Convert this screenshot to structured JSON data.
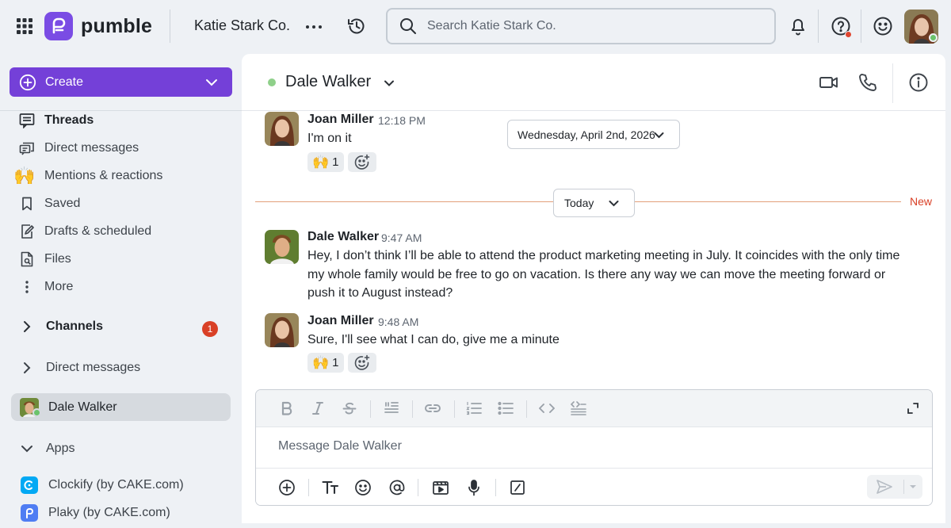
{
  "app": {
    "brand": "pumble",
    "workspace": "Katie Stark Co.",
    "search_placeholder": "Search Katie Stark Co."
  },
  "sidebar": {
    "create_label": "Create",
    "nav": [
      {
        "label": "Threads",
        "icon": "threads-icon",
        "bold": true
      },
      {
        "label": "Direct messages",
        "icon": "direct-messages-icon"
      },
      {
        "label": "Mentions & reactions",
        "icon": "raised-hands-icon"
      },
      {
        "label": "Saved",
        "icon": "bookmark-icon"
      },
      {
        "label": "Drafts & scheduled",
        "icon": "drafts-icon"
      },
      {
        "label": "Files",
        "icon": "files-icon"
      },
      {
        "label": "More",
        "icon": "more-vertical-icon"
      }
    ],
    "channels_label": "Channels",
    "channels_badge": "1",
    "direct_messages_label": "Direct messages",
    "active_dm": "Dale Walker",
    "apps_label": "Apps",
    "apps": [
      {
        "label": "Clockify (by CAKE.com)",
        "color": "#03a9f4"
      },
      {
        "label": "Plaky (by CAKE.com)",
        "color": "#4f7df3"
      }
    ]
  },
  "chat": {
    "title": "Dale Walker",
    "date_pill": "Wednesday, April 2nd, 2026",
    "today_label": "Today",
    "new_label": "New",
    "messages": [
      {
        "author": "Joan Miller",
        "time": "12:18 PM",
        "lines": [
          "I'm on it"
        ],
        "reaction": {
          "emoji": "🙌",
          "count": "1"
        }
      },
      {
        "author": "Dale Walker",
        "time": "9:47 AM",
        "lines": [
          "Hey, I don’t think I’ll be able to attend the product marketing meeting in July. It coincides with the only time",
          "my whole family would be free to go on vacation. Is there any way we can move the meeting forward or",
          "push it to August instead?"
        ]
      },
      {
        "author": "Joan Miller",
        "time": "9:48 AM",
        "lines": [
          "Sure, I'll see what I can do, give me a minute"
        ],
        "reaction": {
          "emoji": "🙌",
          "count": "1"
        }
      }
    ],
    "composer_placeholder": "Message Dale Walker"
  },
  "colors": {
    "brand": "#7440d8",
    "badge": "#d94026",
    "online": "#6bc36b",
    "new_divider": "#e2a07a"
  }
}
